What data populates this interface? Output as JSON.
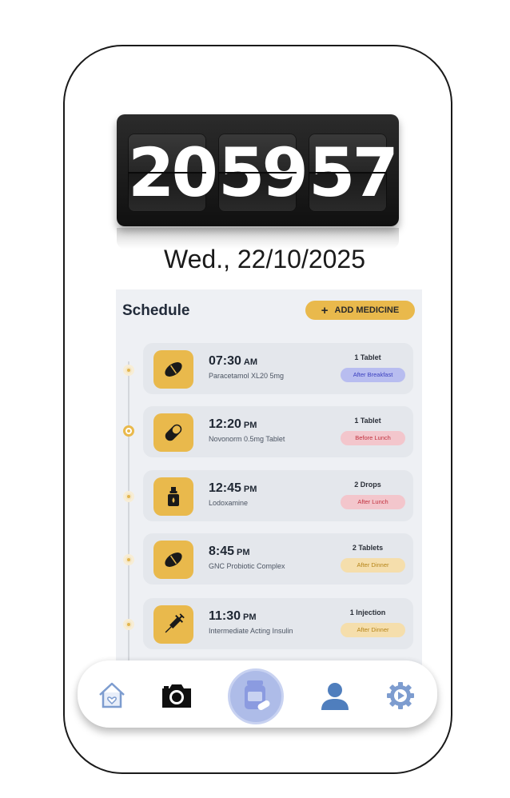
{
  "clock": {
    "hours": "20",
    "minutes": "59",
    "seconds": "57"
  },
  "date": "Wed.,  22/10/2025",
  "schedule": {
    "title": "Schedule",
    "add_button_label": "ADD MEDICINE",
    "items": [
      {
        "time": "07:30",
        "ampm": "AM",
        "name": "Paracetamol XL20 5mg",
        "dose": "1 Tablet",
        "tag": "After Breakfast",
        "tag_color": "#b8bdf0",
        "icon": "pill-oval-icon"
      },
      {
        "time": "12:20",
        "ampm": "PM",
        "name": "Novonorm 0.5mg Tablet",
        "dose": "1 Tablet",
        "tag": "Before Lunch",
        "tag_color": "#f3c6cc",
        "icon": "capsule-icon"
      },
      {
        "time": "12:45",
        "ampm": "PM",
        "name": "Lodoxamine",
        "dose": "2 Drops",
        "tag": "After Lunch",
        "tag_color": "#f3c6cc",
        "icon": "dropper-bottle-icon"
      },
      {
        "time": "8:45",
        "ampm": "PM",
        "name": "GNC Probiotic Complex",
        "dose": "2 Tablets",
        "tag": "After Dinner",
        "tag_color": "#f5deac",
        "icon": "pill-oval-icon"
      },
      {
        "time": "11:30",
        "ampm": "PM",
        "name": "Intermediate Acting Insulin",
        "dose": "1 Injection",
        "tag": "After Dinner",
        "tag_color": "#f5deac",
        "icon": "syringe-icon"
      }
    ]
  },
  "nav": {
    "items": [
      "home-icon",
      "camera-icon",
      "medicine-icon",
      "profile-icon",
      "settings-icon"
    ],
    "active": "medicine-icon"
  },
  "colors": {
    "accent": "#e9b94c",
    "panel": "#eef0f4",
    "card": "#e4e7ec",
    "nav_active": "#aebce8"
  }
}
